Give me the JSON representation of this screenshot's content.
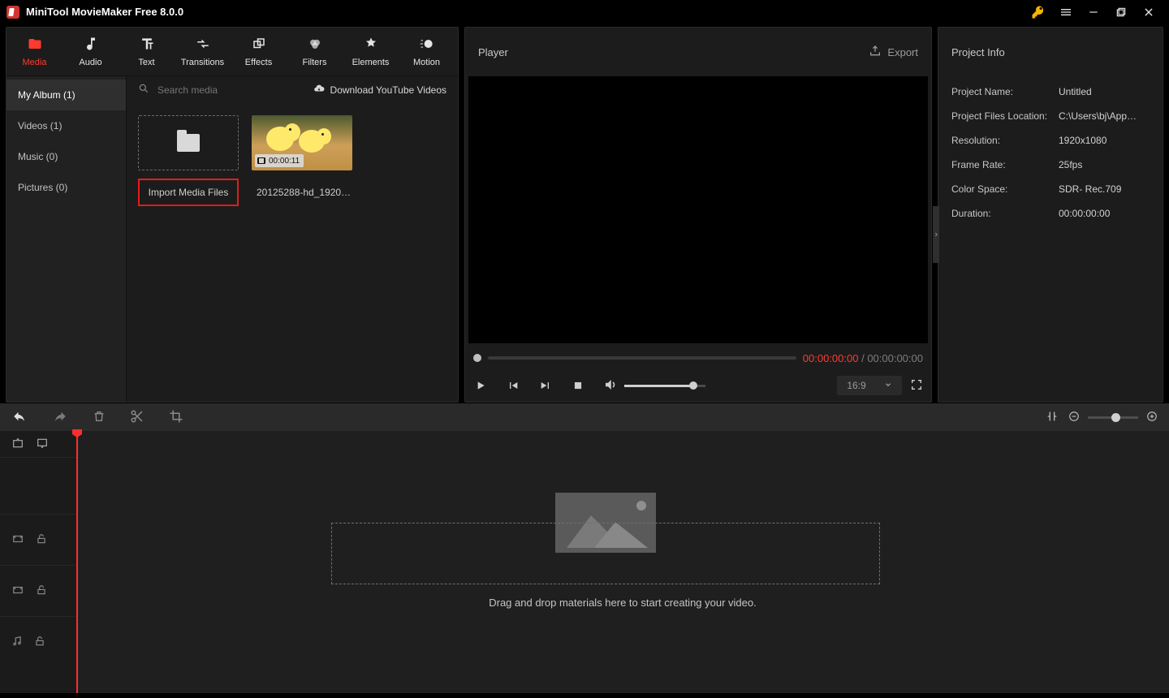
{
  "titlebar": {
    "title": "MiniTool MovieMaker Free 8.0.0"
  },
  "tabs": [
    {
      "label": "Media",
      "name": "tab-media",
      "active": true
    },
    {
      "label": "Audio",
      "name": "tab-audio"
    },
    {
      "label": "Text",
      "name": "tab-text"
    },
    {
      "label": "Transitions",
      "name": "tab-transitions"
    },
    {
      "label": "Effects",
      "name": "tab-effects"
    },
    {
      "label": "Filters",
      "name": "tab-filters"
    },
    {
      "label": "Elements",
      "name": "tab-elements"
    },
    {
      "label": "Motion",
      "name": "tab-motion"
    }
  ],
  "sidebar": {
    "items": [
      {
        "label": "My Album (1)",
        "name": "sidebar-item-myalbum",
        "active": true
      },
      {
        "label": "Videos (1)",
        "name": "sidebar-item-videos"
      },
      {
        "label": "Music (0)",
        "name": "sidebar-item-music"
      },
      {
        "label": "Pictures (0)",
        "name": "sidebar-item-pictures"
      }
    ]
  },
  "search": {
    "placeholder": "Search media"
  },
  "download_label": "Download YouTube Videos",
  "import_label": "Import Media Files",
  "clip": {
    "duration": "00:00:11",
    "name": "20125288-hd_1920…"
  },
  "player": {
    "title": "Player",
    "export": "Export",
    "time_current": "00:00:00:00",
    "time_sep": " / ",
    "time_total": "00:00:00:00",
    "aspect": "16:9"
  },
  "project": {
    "title": "Project Info",
    "rows": [
      {
        "k": "Project Name:",
        "v": "Untitled"
      },
      {
        "k": "Project Files Location:",
        "v": "C:\\Users\\bj\\App…"
      },
      {
        "k": "Resolution:",
        "v": "1920x1080"
      },
      {
        "k": "Frame Rate:",
        "v": "25fps"
      },
      {
        "k": "Color Space:",
        "v": "SDR- Rec.709"
      },
      {
        "k": "Duration:",
        "v": "00:00:00:00"
      }
    ]
  },
  "timeline": {
    "hint": "Drag and drop materials here to start creating your video."
  }
}
